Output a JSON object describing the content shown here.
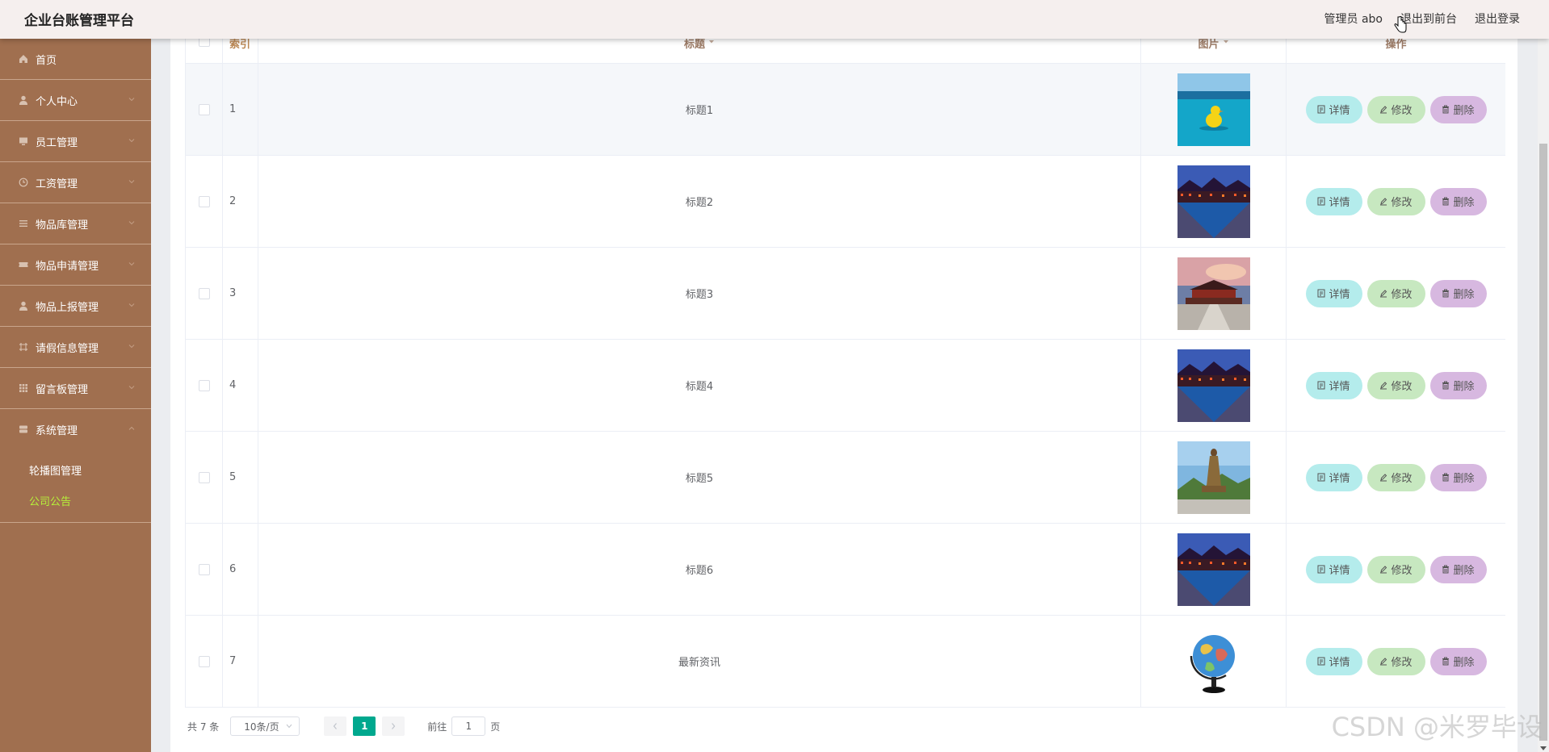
{
  "header": {
    "title": "企业台账管理平台",
    "user": "管理员 abo",
    "to_front": "退出到前台",
    "logout": "退出登录"
  },
  "sidebar": {
    "items": [
      {
        "label": "首页",
        "icon": "home-icon"
      },
      {
        "label": "个人中心",
        "icon": "user-icon"
      },
      {
        "label": "员工管理",
        "icon": "monitor-icon"
      },
      {
        "label": "工资管理",
        "icon": "clock-icon"
      },
      {
        "label": "物品库管理",
        "icon": "list-icon"
      },
      {
        "label": "物品申请管理",
        "icon": "ticket-icon"
      },
      {
        "label": "物品上报管理",
        "icon": "user-icon"
      },
      {
        "label": "请假信息管理",
        "icon": "frame-icon"
      },
      {
        "label": "留言板管理",
        "icon": "grid-icon"
      },
      {
        "label": "系统管理",
        "icon": "stack-icon"
      }
    ],
    "sub_items": [
      {
        "label": "轮播图管理",
        "active": false
      },
      {
        "label": "公司公告",
        "active": true
      }
    ]
  },
  "table": {
    "headers": {
      "index": "索引",
      "title": "标题",
      "image": "图片",
      "ops": "操作"
    },
    "rows": [
      {
        "index": "1",
        "title": "标题1",
        "image": "pool-duck"
      },
      {
        "index": "2",
        "title": "标题2",
        "image": "night-town"
      },
      {
        "index": "3",
        "title": "标题3",
        "image": "palace-sunset"
      },
      {
        "index": "4",
        "title": "标题4",
        "image": "night-town"
      },
      {
        "index": "5",
        "title": "标题5",
        "image": "buddha-statue"
      },
      {
        "index": "6",
        "title": "标题6",
        "image": "night-town"
      },
      {
        "index": "7",
        "title": "最新资讯",
        "image": "globe"
      }
    ],
    "btn_detail": "详情",
    "btn_edit": "修改",
    "btn_delete": "删除"
  },
  "pager": {
    "total": "共 7 条",
    "page_size": "10条/页",
    "current": "1",
    "goto_prefix": "前往",
    "goto_value": "1",
    "goto_suffix": "页"
  },
  "watermark": "CSDN @米罗毕设",
  "colors": {
    "sidebar": "#a06f4f",
    "active_sub": "#b6f23a",
    "pager_active": "#00a88e"
  }
}
